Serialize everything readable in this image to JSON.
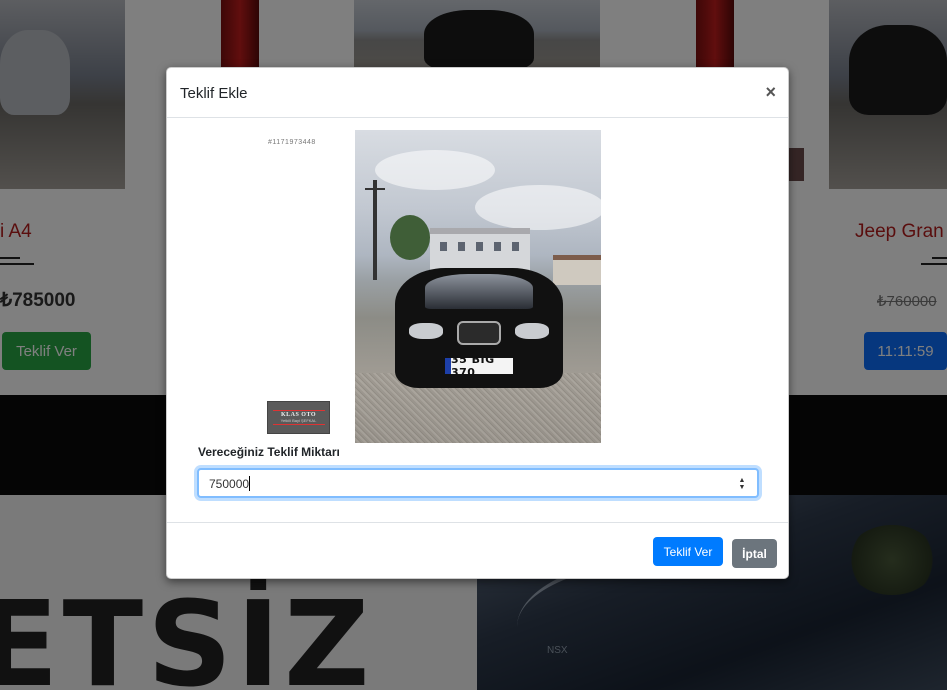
{
  "background": {
    "left_car": {
      "title": "i A4",
      "price": "₺785000",
      "button_label": "Teklif Ver"
    },
    "right_car": {
      "title": "Jeep Gran",
      "price": "₺760000",
      "button_label": "11:11:59"
    },
    "banner_word": "ETSİZ",
    "bottom_photo_badge": "NSX"
  },
  "modal": {
    "title": "Teklif Ekle",
    "close_symbol": "×",
    "listing_id": "#1171973448",
    "logo": {
      "name": "KLAS OTO",
      "subtitle": "Yetkili Bayi ŞEFKAL"
    },
    "car_plate": "35 BIG 370",
    "bid": {
      "label": "Vereceğiniz Teklif Miktarı",
      "value": "750000"
    },
    "footer": {
      "submit_label": "Teklif Ver",
      "cancel_label": "İptal"
    }
  },
  "colors": {
    "primary": "#007bff",
    "secondary": "#6c757d",
    "success": "#28a745",
    "title_red": "#b51d1d"
  }
}
